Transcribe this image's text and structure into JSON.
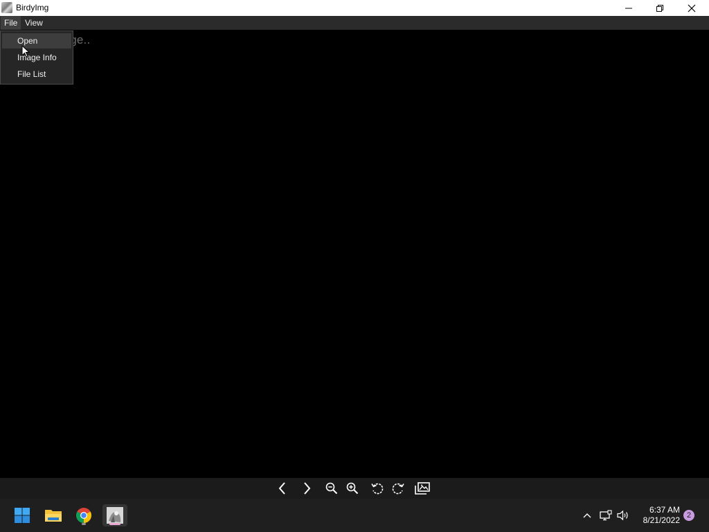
{
  "window": {
    "title": "BirdyImg",
    "controls": {
      "minimize": "minimize-icon",
      "maximize": "restore-icon",
      "close": "close-icon"
    }
  },
  "menubar": {
    "items": [
      {
        "label": "File",
        "active": true
      },
      {
        "label": "View",
        "active": false
      }
    ]
  },
  "placeholder_text": "Open Image..",
  "dropdown": {
    "items": [
      {
        "label": "Open",
        "highlighted": true
      },
      {
        "label": "Image Info",
        "highlighted": false
      },
      {
        "label": "File List",
        "highlighted": false
      }
    ]
  },
  "toolbar": {
    "buttons": [
      "previous-icon",
      "next-icon",
      "zoom-out-icon",
      "zoom-in-icon",
      "rotate-left-icon",
      "rotate-right-icon",
      "gallery-icon"
    ]
  },
  "taskbar": {
    "apps": [
      "start-icon",
      "file-explorer-icon",
      "chrome-icon",
      "birdyimg-icon"
    ],
    "tray": [
      "chevron-up-icon",
      "network-icon",
      "volume-icon"
    ],
    "clock": {
      "time": "6:37 AM",
      "date": "8/21/2022"
    },
    "notifications_count": "2"
  },
  "colors": {
    "titlebar": "#ffffff",
    "menubar": "#2b2b2b",
    "canvas": "#000000",
    "toolbar": "#1b1b1b",
    "taskbar": "#1f1f1f",
    "badge": "#c99be0"
  }
}
